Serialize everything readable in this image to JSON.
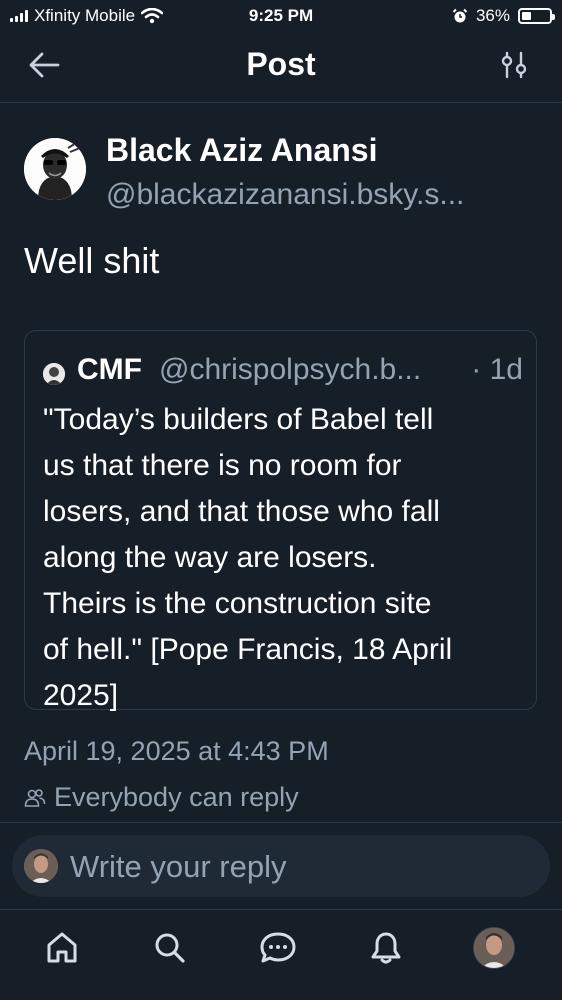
{
  "status": {
    "carrier": "Xfinity Mobile",
    "time": "9:25 PM",
    "battery": "36%",
    "battery_level": 0.36
  },
  "header": {
    "title": "Post"
  },
  "post": {
    "author_name": "Black Aziz Anansi",
    "author_handle": "@blackazizanansi.bsky.s...",
    "text": "Well shit",
    "timestamp": "April 19, 2025 at 4:43 PM",
    "reply_setting": "Everybody can reply"
  },
  "quote": {
    "name": "CMF",
    "handle": "@chrispolpsych.b...",
    "time": "· 1d",
    "lines": [
      "\"Today’s builders of Babel tell",
      "us that there is no room for",
      "losers, and that those who fall",
      "along the way are losers.",
      "Theirs is the construction site",
      "of hell.\" [Pope Francis, 18 April",
      "2025]"
    ]
  },
  "reply": {
    "placeholder": "Write your reply"
  },
  "tabs": [
    "home-icon",
    "search-icon",
    "chat-icon",
    "bell-icon",
    "profile-avatar"
  ],
  "colors": {
    "background": "#161e27",
    "text": "#f1f3f5",
    "muted": "#94a3b4",
    "border": "#2e3b49",
    "input": "#1f2a36"
  }
}
